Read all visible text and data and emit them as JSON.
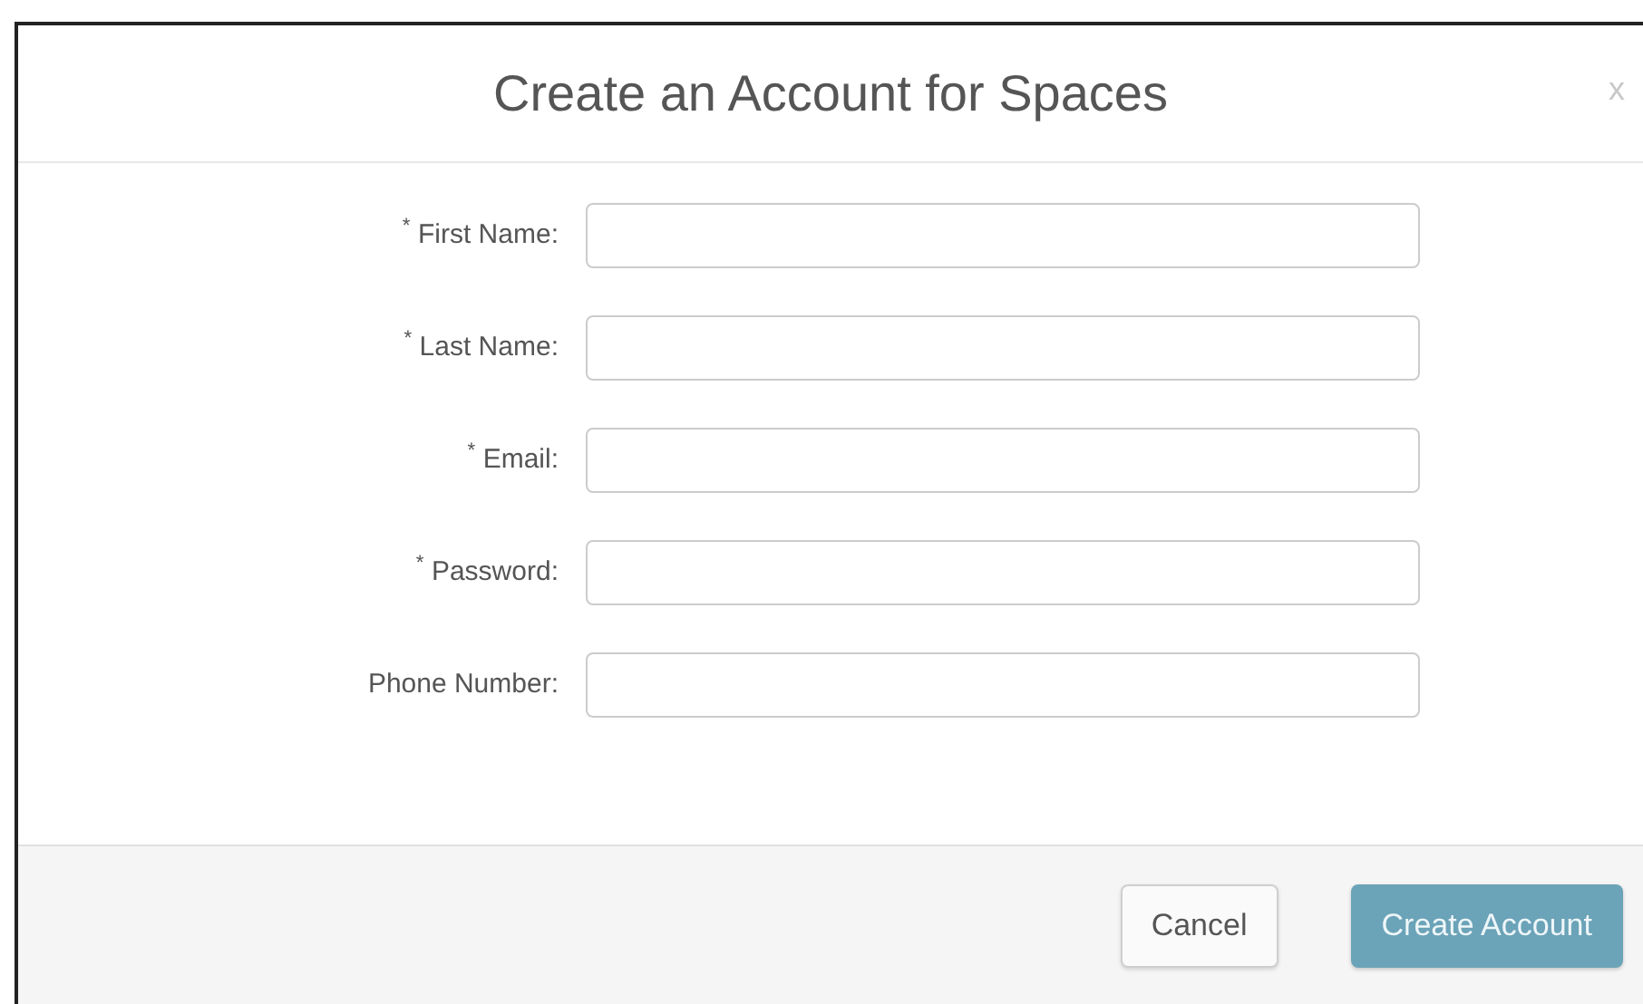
{
  "dialog": {
    "title": "Create an Account for Spaces",
    "close": "x"
  },
  "fields": [
    {
      "label": "$^{*}$ First Name:"
    },
    {
      "label": "$^{*}$ Last Name:"
    },
    {
      "label": "$^{*}$ Email:"
    },
    {
      "label": "$^{*}$ Password:"
    },
    {
      "label": "Phone Number:"
    }
  ],
  "buttons": [
    {
      "label": "Cancel",
      "kind": "default"
    },
    {
      "label": "Create Account",
      "kind": "primary"
    }
  ]
}
